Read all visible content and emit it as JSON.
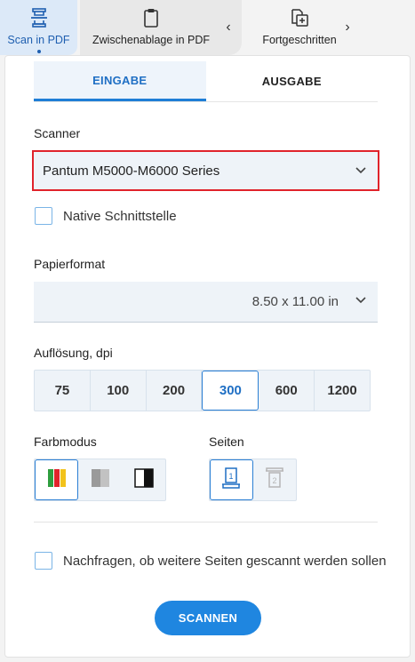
{
  "toolbar": {
    "scan_pdf_label": "Scan in PDF",
    "clipboard_pdf_label": "Zwischenablage in PDF",
    "advanced_label": "Fortgeschritten",
    "prev_arrow": "‹",
    "next_arrow": "›"
  },
  "tabs": {
    "input": "EINGABE",
    "output": "AUSGABE"
  },
  "scanner": {
    "label": "Scanner",
    "value": "Pantum M5000-M6000 Series"
  },
  "native_interface": {
    "label": "Native Schnittstelle",
    "checked": false
  },
  "paper": {
    "label": "Papierformat",
    "value": "8.50 x 11.00 in"
  },
  "resolution": {
    "label": "Auflösung, dpi",
    "options": [
      "75",
      "100",
      "200",
      "300",
      "600",
      "1200"
    ],
    "selected": "300"
  },
  "color_mode": {
    "label": "Farbmodus",
    "options": [
      "color-mode-icon",
      "grayscale-mode-icon",
      "black-white-mode-icon"
    ],
    "selected": "color-mode-icon"
  },
  "pages": {
    "label": "Seiten",
    "options": [
      "single-side-icon",
      "double-side-icon"
    ],
    "selected": "single-side-icon"
  },
  "ask_more_pages": {
    "label": "Nachfragen, ob weitere Seiten gescannt werden sollen",
    "checked": false
  },
  "scan_button": "SCANNEN",
  "colors": {
    "accent": "#1f86e0",
    "highlight_border": "#e0232b",
    "field_bg": "#eef3f8"
  }
}
